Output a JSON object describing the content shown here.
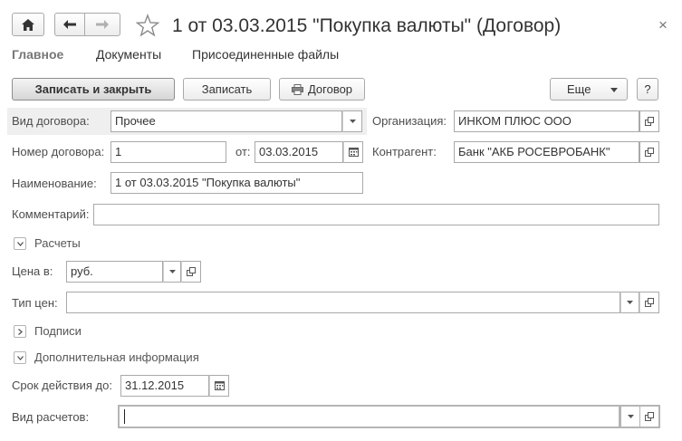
{
  "window": {
    "title": "1 от 03.03.2015 \"Покупка валюты\" (Договор)"
  },
  "icons": {
    "home": "home-icon",
    "back": "arrow-left-icon",
    "forward": "arrow-right-icon",
    "favorite": "star-icon",
    "close": "close-icon",
    "printer": "printer-icon",
    "calendar": "calendar-icon",
    "open": "open-window-icon",
    "dropdown": "chevron-down-icon"
  },
  "tabs": [
    {
      "label": "Главное"
    },
    {
      "label": "Документы"
    },
    {
      "label": "Присоединенные файлы"
    }
  ],
  "toolbar": {
    "save_close_label": "Записать и закрыть",
    "save_label": "Записать",
    "contract_label": "Договор",
    "more_label": "Еще",
    "help_label": "?",
    "close_glyph": "×"
  },
  "form": {
    "contract_type": {
      "label": "Вид договора:",
      "value": "Прочее"
    },
    "organization": {
      "label": "Организация:",
      "value": "ИНКОМ ПЛЮС ООО"
    },
    "contract_number": {
      "label": "Номер договора:",
      "value": "1"
    },
    "date": {
      "label": "от:",
      "value": "03.03.2015"
    },
    "counterparty": {
      "label": "Контрагент:",
      "value": "Банк \"АКБ РОСЕВРОБАНК\""
    },
    "name": {
      "label": "Наименование:",
      "value": "1 от 03.03.2015 \"Покупка валюты\""
    },
    "comment": {
      "label": "Комментарий:",
      "value": ""
    },
    "settlements_group": {
      "label": "Расчеты"
    },
    "price_in": {
      "label": "Цена в:",
      "value": "руб."
    },
    "price_type": {
      "label": "Тип цен:",
      "value": ""
    },
    "signatures_group": {
      "label": "Подписи"
    },
    "additional_group": {
      "label": "Дополнительная информация"
    },
    "valid_until": {
      "label": "Срок действия до:",
      "value": "31.12.2015"
    },
    "settlement_kind": {
      "label": "Вид расчетов:",
      "value": ""
    }
  }
}
